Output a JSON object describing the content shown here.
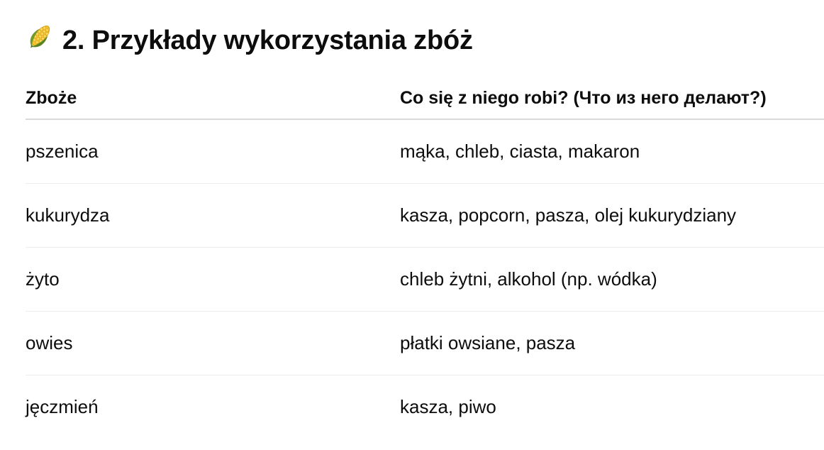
{
  "section": {
    "icon": "corn-icon",
    "title": "2. Przykłady wykorzystania zbóż"
  },
  "table": {
    "headers": [
      "Zboże",
      "Co się z niego robi? (Что из него делают?)"
    ],
    "rows": [
      [
        "pszenica",
        "mąka, chleb, ciasta, makaron"
      ],
      [
        "kukurydza",
        "kasza, popcorn, pasza, olej kukurydziany"
      ],
      [
        "żyto",
        "chleb żytni, alkohol (np. wódka)"
      ],
      [
        "owies",
        "płatki owsiane, pasza"
      ],
      [
        "jęczmień",
        "kasza, piwo"
      ]
    ]
  },
  "colors": {
    "text": "#0d0d0d",
    "header_rule": "#d9d9d9",
    "row_rule": "#ececec",
    "corn_kernel": "#f2c230",
    "corn_husk": "#6f9a2c"
  }
}
